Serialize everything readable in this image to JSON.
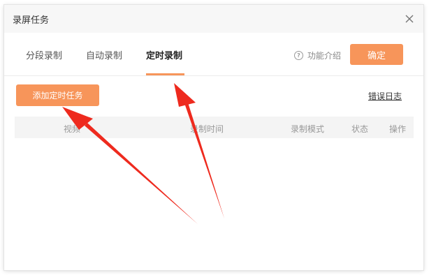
{
  "dialog": {
    "title": "录屏任务",
    "close_icon": "close-icon"
  },
  "tabs": [
    {
      "label": "分段录制",
      "active": false
    },
    {
      "label": "自动录制",
      "active": false
    },
    {
      "label": "定时录制",
      "active": true
    }
  ],
  "toolbar": {
    "help_label": "功能介绍",
    "help_icon": "question-circle-icon",
    "confirm_label": "确定"
  },
  "actions": {
    "add_task_label": "添加定时任务",
    "error_log_label": "错误日志"
  },
  "table": {
    "columns": [
      "视频",
      "录制时间",
      "录制模式",
      "状态",
      "操作"
    ],
    "rows": []
  },
  "colors": {
    "accent": "#f7955a",
    "annotation_arrow": "#ee2a1e"
  }
}
